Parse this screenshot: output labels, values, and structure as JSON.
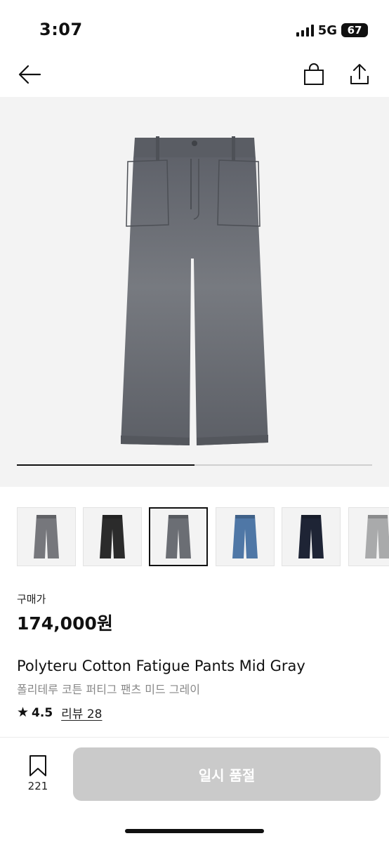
{
  "status_bar": {
    "time": "3:07",
    "network": "5G",
    "battery": "67"
  },
  "nav": {
    "back_icon": "arrow-left-icon",
    "bag_icon": "shopping-bag-icon",
    "share_icon": "share-icon"
  },
  "hero": {
    "background": "#f3f3f3",
    "product_color": "#6b6e74",
    "carousel_position_fraction": 0.5
  },
  "thumbnails": [
    {
      "color": "#76777c",
      "selected": false
    },
    {
      "color": "#2b2b2b",
      "selected": false
    },
    {
      "color": "#6b6e74",
      "selected": true
    },
    {
      "color": "#4f77a6",
      "selected": false
    },
    {
      "color": "#1e2435",
      "selected": false
    },
    {
      "color": "#a9aaab",
      "selected": false
    }
  ],
  "product": {
    "price_label": "구매가",
    "price": "174,000원",
    "name_en": "Polyteru Cotton Fatigue Pants Mid Gray",
    "name_ko": "폴리테루 코튼 퍼티그 팬츠 미드 그레이",
    "rating": "4.5",
    "reviews": "리뷰 28"
  },
  "bottom_bar": {
    "bookmark_icon": "bookmark-icon",
    "bookmark_count": "221",
    "buy_label": "일시 품절",
    "buy_color": "#cacaca"
  }
}
